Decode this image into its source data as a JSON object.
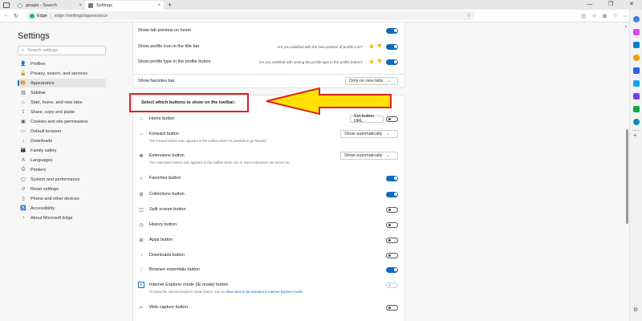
{
  "browser": {
    "tabs": [
      {
        "title": "google - Search",
        "active": false
      },
      {
        "title": "Settings",
        "active": true
      }
    ],
    "address": {
      "site_label": "Edge",
      "url": "edge://settings/appearance"
    },
    "window_controls": [
      "—",
      "❐",
      "✕"
    ]
  },
  "sidebar": {
    "title": "Settings",
    "search_placeholder": "Search settings",
    "items": [
      {
        "label": "Profiles",
        "icon": "person-icon",
        "glyph": "👤"
      },
      {
        "label": "Privacy, search, and services",
        "icon": "lock-icon",
        "glyph": "🔒"
      },
      {
        "label": "Appearance",
        "icon": "palette-icon",
        "glyph": "🎨",
        "selected": true
      },
      {
        "label": "Sidebar",
        "icon": "sidebar-icon",
        "glyph": "▥"
      },
      {
        "label": "Start, home, and new tabs",
        "icon": "home-icon",
        "glyph": "⌂"
      },
      {
        "label": "Share, copy and paste",
        "icon": "share-icon",
        "glyph": "⇪"
      },
      {
        "label": "Cookies and site permissions",
        "icon": "cookie-icon",
        "glyph": "▣"
      },
      {
        "label": "Default browser",
        "icon": "browser-icon",
        "glyph": "▭"
      },
      {
        "label": "Downloads",
        "icon": "download-icon",
        "glyph": "↓"
      },
      {
        "label": "Family safety",
        "icon": "family-icon",
        "glyph": "👪"
      },
      {
        "label": "Languages",
        "icon": "language-icon",
        "glyph": "A"
      },
      {
        "label": "Printers",
        "icon": "printer-icon",
        "glyph": "⎙"
      },
      {
        "label": "System and performance",
        "icon": "system-icon",
        "glyph": "▢"
      },
      {
        "label": "Reset settings",
        "icon": "reset-icon",
        "glyph": "↺"
      },
      {
        "label": "Phone and other devices",
        "icon": "phone-icon",
        "glyph": "▯"
      },
      {
        "label": "Accessibility",
        "icon": "accessibility-icon",
        "glyph": "♿"
      },
      {
        "label": "About Microsoft Edge",
        "icon": "edge-icon",
        "glyph": "◔"
      }
    ]
  },
  "main": {
    "top_rows": [
      {
        "label": "Show tab preview on hover",
        "toggle": "on"
      },
      {
        "label": "Show profile icon in the title bar",
        "question": "Are you satisfied with the new position of profile icon?",
        "toggle": "on"
      },
      {
        "label": "Show profile type in the profile button",
        "question": "Are you satisfied with seeing the profile type in the profile button?",
        "toggle": "on"
      }
    ],
    "favorites_bar": {
      "label": "Show favorites bar",
      "value": "Only on new tabs"
    },
    "toolbar_section_title": "Select which buttons to show on the toolbar:",
    "toolbar_rows": [
      {
        "label": "Home button",
        "icon": "home-icon",
        "glyph": "⌂",
        "button": "Set button URL",
        "toggle": "off"
      },
      {
        "label": "Forward button",
        "icon": "forward-icon",
        "glyph": "→",
        "dropdown": "Show automatically",
        "desc": "The forward button auto appears in the toolbar when it's possible to go forward."
      },
      {
        "label": "Extensions button",
        "icon": "puzzle-icon",
        "glyph": "✤",
        "dropdown": "Show automatically",
        "desc": "The extensions button auto appears in the toolbar when one or more extensions are turned on."
      },
      {
        "label": "Favorites button",
        "icon": "star-icon",
        "glyph": "☆",
        "toggle": "on"
      },
      {
        "label": "Collections button",
        "icon": "collections-icon",
        "glyph": "⊞",
        "toggle": "on"
      },
      {
        "label": "Split screen button",
        "icon": "split-screen-icon",
        "glyph": "◫",
        "toggle": "off"
      },
      {
        "label": "History button",
        "icon": "history-icon",
        "glyph": "◷",
        "toggle": "off"
      },
      {
        "label": "Apps button",
        "icon": "apps-icon",
        "glyph": "⊞",
        "toggle": "off"
      },
      {
        "label": "Downloads button",
        "icon": "download-icon",
        "glyph": "↓",
        "toggle": "off"
      },
      {
        "label": "Browser essentials button",
        "icon": "heart-icon",
        "glyph": "♡",
        "toggle": "on"
      },
      {
        "label": "Internet Explorer mode (IE mode) button",
        "icon": "ie-icon",
        "glyph": "e",
        "toggle": "disabled",
        "desc_pre": "To show the Internet Explorer mode button, turn on ",
        "desc_link": "allow sites to be reloaded in Internet Explorer mode"
      },
      {
        "label": "Web capture button",
        "icon": "capture-icon",
        "glyph": "✂",
        "toggle": "off"
      }
    ]
  },
  "colors": {
    "accent": "#0f6cbd",
    "annotation_red": "#e02020",
    "arrow_fill": "#ffe000"
  }
}
